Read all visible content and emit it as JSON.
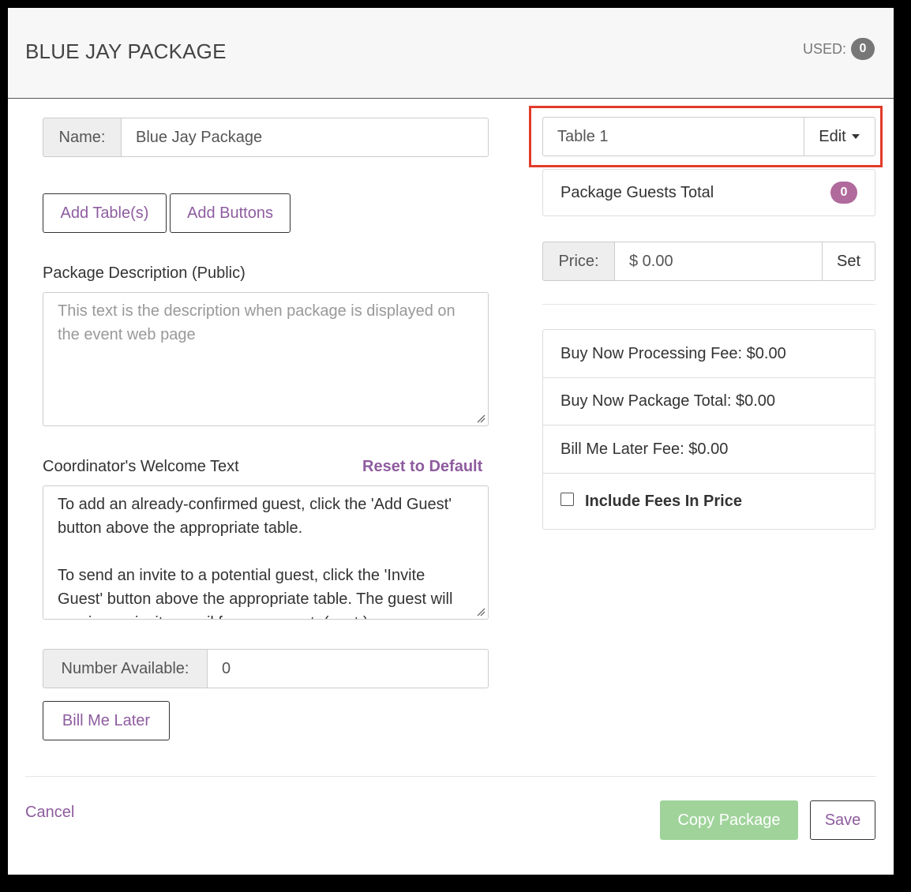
{
  "header": {
    "title": "BLUE JAY PACKAGE",
    "used_label": "USED:",
    "used_count": "0"
  },
  "name_field": {
    "label": "Name:",
    "value": "Blue Jay Package"
  },
  "buttons": {
    "add_tables": "Add Table(s)",
    "add_buttons": "Add Buttons",
    "bill_me_later": "Bill Me Later"
  },
  "description": {
    "label": "Package Description (Public)",
    "placeholder": "This text is the description when package is displayed on the event web page"
  },
  "welcome": {
    "label": "Coordinator's Welcome Text",
    "reset_label": "Reset to Default",
    "paragraph1": "To add an already-confirmed guest, click the 'Add Guest' button above the appropriate table.",
    "paragraph2": "To send an invite to a potential guest, click the 'Invite Guest' button above the appropriate table. The guest will receive an invite email for your event. (cont.)"
  },
  "number_available": {
    "label": "Number Available:",
    "value": "0"
  },
  "table_select": {
    "value": "Table 1",
    "edit_label": "Edit",
    "highlight_color": "#e23b2a"
  },
  "guests_total": {
    "label": "Package Guests Total",
    "count": "0"
  },
  "price": {
    "label": "Price:",
    "value": "$ 0.00",
    "set_label": "Set"
  },
  "fees": {
    "processing_fee": "Buy Now Processing Fee: $0.00",
    "package_total": "Buy Now Package Total: $0.00",
    "bill_later_fee": "Bill Me Later Fee: $0.00",
    "include_fees_label": "Include Fees In Price",
    "include_fees_checked": false
  },
  "footer": {
    "cancel_label": "Cancel",
    "copy_label": "Copy Package",
    "save_label": "Save"
  }
}
